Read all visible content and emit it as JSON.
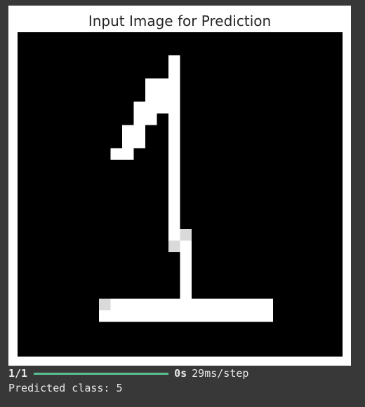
{
  "figure": {
    "title": "Input Image for Prediction",
    "image_pixels": {
      "background": "#000000",
      "stroke": "#ffffff",
      "soft": "#dadada"
    }
  },
  "output": {
    "step_count": "1/1",
    "progress": 1.0,
    "elapsed": "0s",
    "step_time": "29ms/step",
    "prediction_label": "Predicted class:",
    "prediction_value": "5"
  },
  "colors": {
    "page_background": "#383838",
    "progress_bar": "#5ac090",
    "output_text": "#e8e8e8"
  }
}
